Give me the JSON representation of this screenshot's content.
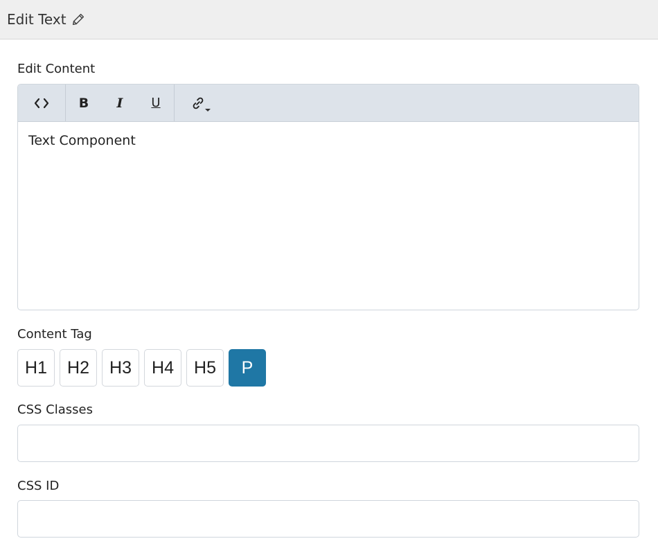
{
  "header": {
    "title": "Edit Text",
    "icon": "pencil-icon"
  },
  "edit_content": {
    "label": "Edit Content",
    "toolbar": {
      "code_label": "<>",
      "bold_label": "B",
      "italic_label": "I",
      "underline_label": "U",
      "link_icon": "link-icon"
    },
    "content": "Text Component"
  },
  "content_tag": {
    "label": "Content Tag",
    "options": [
      "H1",
      "H2",
      "H3",
      "H4",
      "H5",
      "P"
    ],
    "selected": "P",
    "active_color": "#1f77a5"
  },
  "css_classes": {
    "label": "CSS Classes",
    "value": ""
  },
  "css_id": {
    "label": "CSS ID",
    "value": ""
  }
}
